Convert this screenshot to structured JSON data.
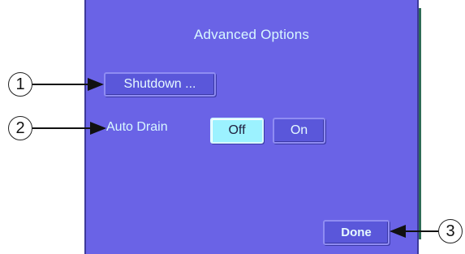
{
  "dialog": {
    "title": "Advanced Options",
    "shutdown_label": "Shutdown ...",
    "auto_drain_label": "Auto Drain",
    "auto_drain_options": [
      "Off",
      "On"
    ],
    "auto_drain_selected": "Off",
    "done_label": "Done"
  },
  "callouts": [
    "1",
    "2",
    "3"
  ],
  "colors": {
    "panel": "#6a63e6",
    "button": "#5a57da",
    "selected_button": "#9cf2ff",
    "text": "#d8f8ff"
  }
}
